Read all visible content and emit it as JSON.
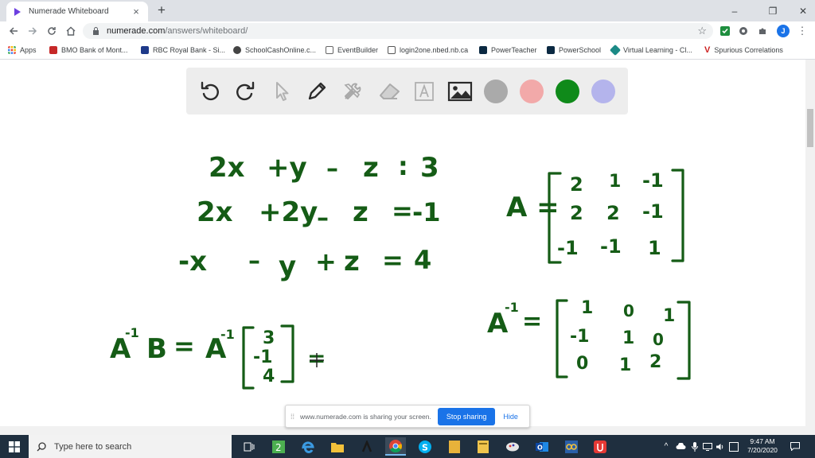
{
  "browser": {
    "tab": {
      "title": "Numerade Whiteboard",
      "close": "×",
      "newtab": "+"
    },
    "window": {
      "minimize": "–",
      "maximize": "❐",
      "close": "✕"
    },
    "url": {
      "host": "numerade.com",
      "path": "/answers/whiteboard/"
    },
    "profile_initial": "J",
    "bookmarks": [
      {
        "label": "Apps",
        "color": "#e94235"
      },
      {
        "label": "BMO Bank of Mont...",
        "color": "#c62828"
      },
      {
        "label": "RBC Royal Bank - Si...",
        "color": "#1e3a8a"
      },
      {
        "label": "SchoolCashOnline.c...",
        "color": "#444444"
      },
      {
        "label": "EventBuilder",
        "color": "#666666"
      },
      {
        "label": "login2one.nbed.nb.ca",
        "color": "#555555"
      },
      {
        "label": "PowerTeacher",
        "color": "#0b2942"
      },
      {
        "label": "PowerSchool",
        "color": "#0b2942"
      },
      {
        "label": "Virtual Learning - Cl...",
        "color": "#1b8a86"
      },
      {
        "label": "Spurious Correlations",
        "color": "#cc1f1f"
      }
    ]
  },
  "whiteboard": {
    "tools": [
      "undo-icon",
      "redo-icon",
      "pointer-icon",
      "pen-icon",
      "tools-icon",
      "eraser-icon",
      "text-icon",
      "image-icon"
    ],
    "swatches": [
      {
        "name": "gray",
        "color": "#aaaaaa"
      },
      {
        "name": "pink",
        "color": "#f2a9a9"
      },
      {
        "name": "green",
        "color": "#0f8a1a"
      },
      {
        "name": "lavender",
        "color": "#b4b4ec"
      }
    ],
    "ink_color": "#155c16",
    "handwriting": {
      "eq1": [
        "2x",
        "+y",
        "–",
        "z",
        ":",
        "3"
      ],
      "eq2": [
        "2x",
        "+2y",
        "–",
        "z",
        "=",
        "-1"
      ],
      "eq3": [
        "-x",
        "–",
        "y",
        "+",
        "z",
        "=",
        "4"
      ],
      "A_label": "A =",
      "A_matrix": [
        [
          "2",
          "1",
          "-1"
        ],
        [
          "2",
          "2",
          "-1"
        ],
        [
          "-1",
          "-1",
          "1"
        ]
      ],
      "Ainv_label": "A",
      "Ainv_exp": "-1",
      "Ainv_eq": "=",
      "Ainv_matrix": [
        [
          "1",
          "0",
          "1"
        ],
        [
          "-1",
          "1",
          "0"
        ],
        [
          "0",
          "1",
          "2"
        ]
      ],
      "lhs": "A",
      "lhs_exp": "-1",
      "lhs_B": "B",
      "mid_eq": "=",
      "rhs_A": "A",
      "rhs_exp": "-1",
      "B_vector": [
        "3",
        "-1",
        "4"
      ],
      "trail_eq": "="
    }
  },
  "share_bar": {
    "message": "www.numerade.com is sharing your screen.",
    "stop": "Stop sharing",
    "hide": "Hide"
  },
  "taskbar": {
    "search_placeholder": "Type here to search",
    "time": "9:47 AM",
    "date": "7/20/2020"
  }
}
